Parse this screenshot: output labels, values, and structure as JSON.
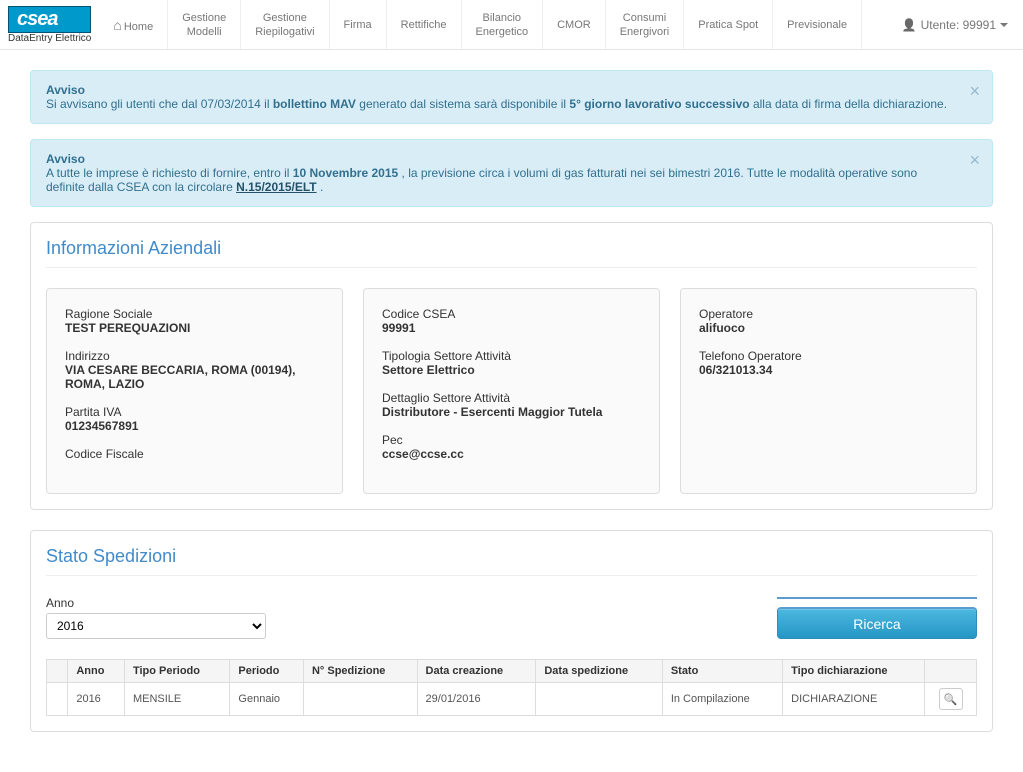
{
  "brand": {
    "logo": "csea",
    "sub": "DataEntry Elettrico"
  },
  "nav": {
    "items": [
      {
        "line1": "Home",
        "line2": ""
      },
      {
        "line1": "Gestione",
        "line2": "Modelli"
      },
      {
        "line1": "Gestione",
        "line2": "Riepilogativi"
      },
      {
        "line1": "Firma",
        "line2": ""
      },
      {
        "line1": "Rettifiche",
        "line2": ""
      },
      {
        "line1": "Bilancio",
        "line2": "Energetico"
      },
      {
        "line1": "CMOR",
        "line2": ""
      },
      {
        "line1": "Consumi",
        "line2": "Energivori"
      },
      {
        "line1": "Pratica Spot",
        "line2": ""
      },
      {
        "line1": "Previsionale",
        "line2": ""
      }
    ],
    "user_label": "Utente: 99991"
  },
  "alerts": [
    {
      "title": "Avviso",
      "pre": "Si avvisano gli utenti che dal 07/03/2014 il ",
      "bold1": "bollettino MAV",
      "mid": " generato dal sistema sarà disponibile il ",
      "bold2": "5° giorno lavorativo successivo",
      "post": " alla data di firma della dichiarazione."
    },
    {
      "title": "Avviso",
      "pre": "A tutte le imprese è richiesto di fornire, entro il ",
      "bold1": "10 Novembre 2015",
      "mid": ", la previsione circa i volumi di gas fatturati nei sei bimestri 2016. Tutte le modalità operative sono definite dalla CSEA con la circolare ",
      "link": "N.15/2015/ELT",
      "post": "."
    }
  ],
  "company": {
    "section_title": "Informazioni Aziendali",
    "col1": {
      "ragione_label": "Ragione Sociale",
      "ragione_value": "TEST PEREQUAZIONI",
      "indirizzo_label": "Indirizzo",
      "indirizzo_value": "VIA CESARE BECCARIA, ROMA (00194), ROMA, LAZIO",
      "piva_label": "Partita IVA",
      "piva_value": "01234567891",
      "cf_label": "Codice Fiscale",
      "cf_value": ""
    },
    "col2": {
      "codice_label": "Codice CSEA",
      "codice_value": "99991",
      "tipologia_label": "Tipologia Settore Attività",
      "tipologia_value": "Settore Elettrico",
      "dettaglio_label": "Dettaglio Settore Attività",
      "dettaglio_value": "Distributore - Esercenti Maggior Tutela",
      "pec_label": "Pec",
      "pec_value": "ccse@ccse.cc"
    },
    "col3": {
      "operatore_label": "Operatore",
      "operatore_value": "alifuoco",
      "telefono_label": "Telefono Operatore",
      "telefono_value": "06/321013.34"
    }
  },
  "shipments": {
    "section_title": "Stato Spedizioni",
    "anno_label": "Anno",
    "anno_value": "2016",
    "search_label": "Ricerca",
    "headers": {
      "c0": "",
      "anno": "Anno",
      "tipo_periodo": "Tipo Periodo",
      "periodo": "Periodo",
      "n_spedizione": "N° Spedizione",
      "data_creazione": "Data creazione",
      "data_spedizione": "Data spedizione",
      "stato": "Stato",
      "tipo_dichiarazione": "Tipo dichiarazione",
      "c9": ""
    },
    "rows": [
      {
        "anno": "2016",
        "tipo_periodo": "MENSILE",
        "periodo": "Gennaio",
        "n_spedizione": "",
        "data_creazione": "29/01/2016",
        "data_spedizione": "",
        "stato": "In Compilazione",
        "tipo_dichiarazione": "DICHIARAZIONE"
      }
    ]
  }
}
